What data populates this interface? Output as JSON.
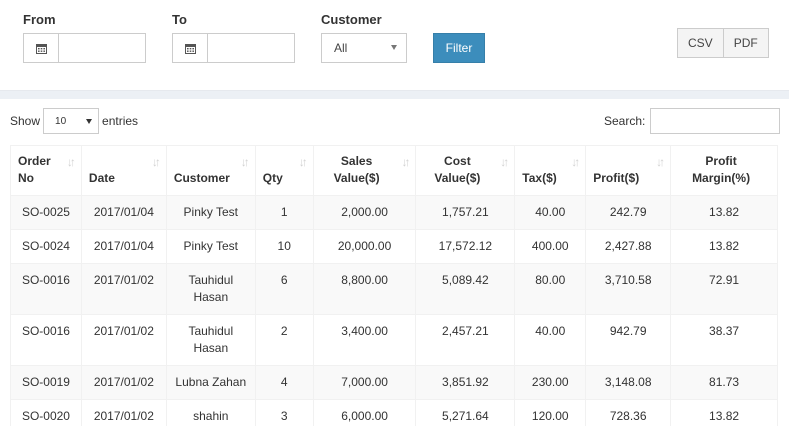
{
  "filters": {
    "from_label": "From",
    "from_value": "",
    "to_label": "To",
    "to_value": "",
    "customer_label": "Customer",
    "customer_selected": "All",
    "filter_button": "Filter"
  },
  "export": {
    "csv": "CSV",
    "pdf": "PDF"
  },
  "table_controls": {
    "show_label": "Show",
    "entries_value": "10",
    "entries_label": "entries",
    "search_label": "Search:",
    "search_value": ""
  },
  "table": {
    "headers": [
      "Order No",
      "Date",
      "Customer",
      "Qty",
      "Sales Value($)",
      "Cost Value($)",
      "Tax($)",
      "Profit($)",
      "Profit Margin(%)"
    ],
    "rows": [
      [
        "SO-0025",
        "2017/01/04",
        "Pinky Test",
        "1",
        "2,000.00",
        "1,757.21",
        "40.00",
        "242.79",
        "13.82"
      ],
      [
        "SO-0024",
        "2017/01/04",
        "Pinky Test",
        "10",
        "20,000.00",
        "17,572.12",
        "400.00",
        "2,427.88",
        "13.82"
      ],
      [
        "SO-0016",
        "2017/01/02",
        "Tauhidul Hasan",
        "6",
        "8,800.00",
        "5,089.42",
        "80.00",
        "3,710.58",
        "72.91"
      ],
      [
        "SO-0016",
        "2017/01/02",
        "Tauhidul Hasan",
        "2",
        "3,400.00",
        "2,457.21",
        "40.00",
        "942.79",
        "38.37"
      ],
      [
        "SO-0019",
        "2017/01/02",
        "Lubna Zahan",
        "4",
        "7,000.00",
        "3,851.92",
        "230.00",
        "3,148.08",
        "81.73"
      ],
      [
        "SO-0020",
        "2017/01/02",
        "shahin",
        "3",
        "6,000.00",
        "5,271.64",
        "120.00",
        "728.36",
        "13.82"
      ]
    ]
  }
}
